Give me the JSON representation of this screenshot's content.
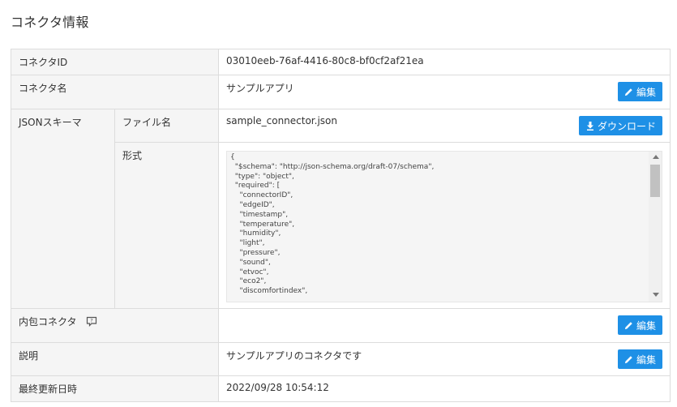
{
  "page": {
    "title": "コネクタ情報"
  },
  "rows": {
    "connector_id": {
      "label": "コネクタID",
      "value": "03010eeb-76af-4416-80c8-bf0cf2af21ea"
    },
    "connector_name": {
      "label": "コネクタ名",
      "value": "サンプルアプリ",
      "button": "編集"
    },
    "json_schema": {
      "label": "JSONスキーマ",
      "file_label": "ファイル名",
      "file_value": "sample_connector.json",
      "download_button": "ダウンロード",
      "format_label": "形式",
      "format_lines": [
        "{",
        "  \"$schema\": \"http://json-schema.org/draft-07/schema\",",
        "  \"type\": \"object\",",
        "  \"required\": [",
        "    \"connectorID\",",
        "    \"edgeID\",",
        "    \"timestamp\",",
        "    \"temperature\",",
        "    \"humidity\",",
        "    \"light\",",
        "    \"pressure\",",
        "    \"sound\",",
        "    \"etvoc\",",
        "    \"eco2\",",
        "    \"discomfortindex\","
      ]
    },
    "inner_connector": {
      "label": "内包コネクタ",
      "button": "編集"
    },
    "description": {
      "label": "説明",
      "value": "サンプルアプリのコネクタです",
      "button": "編集"
    },
    "updated": {
      "label": "最終更新日時",
      "value": "2022/09/28 10:54:12"
    }
  },
  "colors": {
    "accent": "#1e90e6",
    "label_bg": "#f5f5f5",
    "border": "#dcdcdc"
  }
}
